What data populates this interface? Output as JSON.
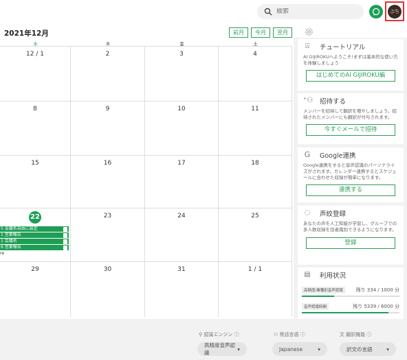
{
  "header": {
    "search_placeholder": "検索",
    "avatar_initials": "ぷち"
  },
  "calendar": {
    "month_title": "2021年12月",
    "nav": [
      "前月",
      "今月",
      "翌月"
    ],
    "weekdays": [
      "水",
      "木",
      "金",
      "土"
    ],
    "weeks": [
      [
        "12 / 1",
        "2",
        "3",
        "4"
      ],
      [
        "8",
        "9",
        "10",
        "11"
      ],
      [
        "15",
        "16",
        "17",
        "18"
      ],
      [
        "22",
        "23",
        "24",
        "25"
      ],
      [
        "29",
        "30",
        "31",
        "1 / 1"
      ]
    ],
    "today_label": "22",
    "events": [
      "5 会議名自由に設定",
      "1 営業報告",
      "1 会議名",
      "6 営業報告"
    ],
    "more_label": "re"
  },
  "panel": {
    "tutorial": {
      "title": "チュートリアル",
      "body": "AI GIJIROKUへようこそ!まずは基本的な使い方を体験しましょう",
      "button": "はじめてのAI GIJIROKU編"
    },
    "invite": {
      "title": "招待する",
      "body": "メンバーを招待して翻訳を増やしましょう。招待されたメンバーにも翻訳が付与されます。",
      "button": "今すぐメールで招待"
    },
    "google": {
      "title": "Google連携",
      "body": "Google連携をすると音声認識のパーソナライズがされます。カレンダー連携するとスケジュールに合わせた収録が簡単になります。",
      "button": "連携する"
    },
    "voice": {
      "title": "声紋登録",
      "body": "あなたの声を人工知能が学習し、グループでの多人数収録を話者識別できるようになります。",
      "button": "登録"
    },
    "usage": {
      "title": "利用状況",
      "items": [
        {
          "tag": "高精度/業種別音声認識",
          "value": "残り 334 / 1000 分",
          "fraction": 0.334
        },
        {
          "tag": "音声認識時間",
          "value": "残り 5339 / 6000 分",
          "fraction": 0.89
        }
      ]
    }
  },
  "footer": {
    "engine_label": "認識エンジン",
    "engine_value": "高精度音声認識",
    "language_label": "発話言語",
    "language_value": "Japanese",
    "translate_label": "翻訳機能",
    "translate_value": "訳文の言語"
  },
  "colors": {
    "accent": "#1e9e55",
    "highlight": "#e53030"
  }
}
